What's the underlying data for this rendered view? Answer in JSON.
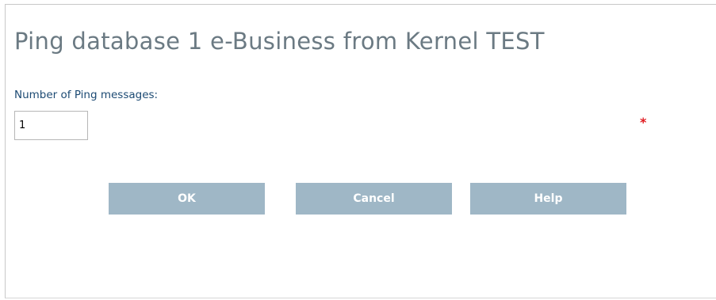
{
  "dialog": {
    "title": "Ping database 1 e-Business from Kernel TEST"
  },
  "form": {
    "ping_count_label": "Number of Ping messages:",
    "ping_count_value": "1",
    "required_marker": "*"
  },
  "buttons": {
    "ok_label": "OK",
    "cancel_label": "Cancel",
    "help_label": "Help"
  },
  "colors": {
    "title": "#6b7a83",
    "label": "#1c4a73",
    "button_bg": "#9fb7c6",
    "required": "#e0191f"
  }
}
